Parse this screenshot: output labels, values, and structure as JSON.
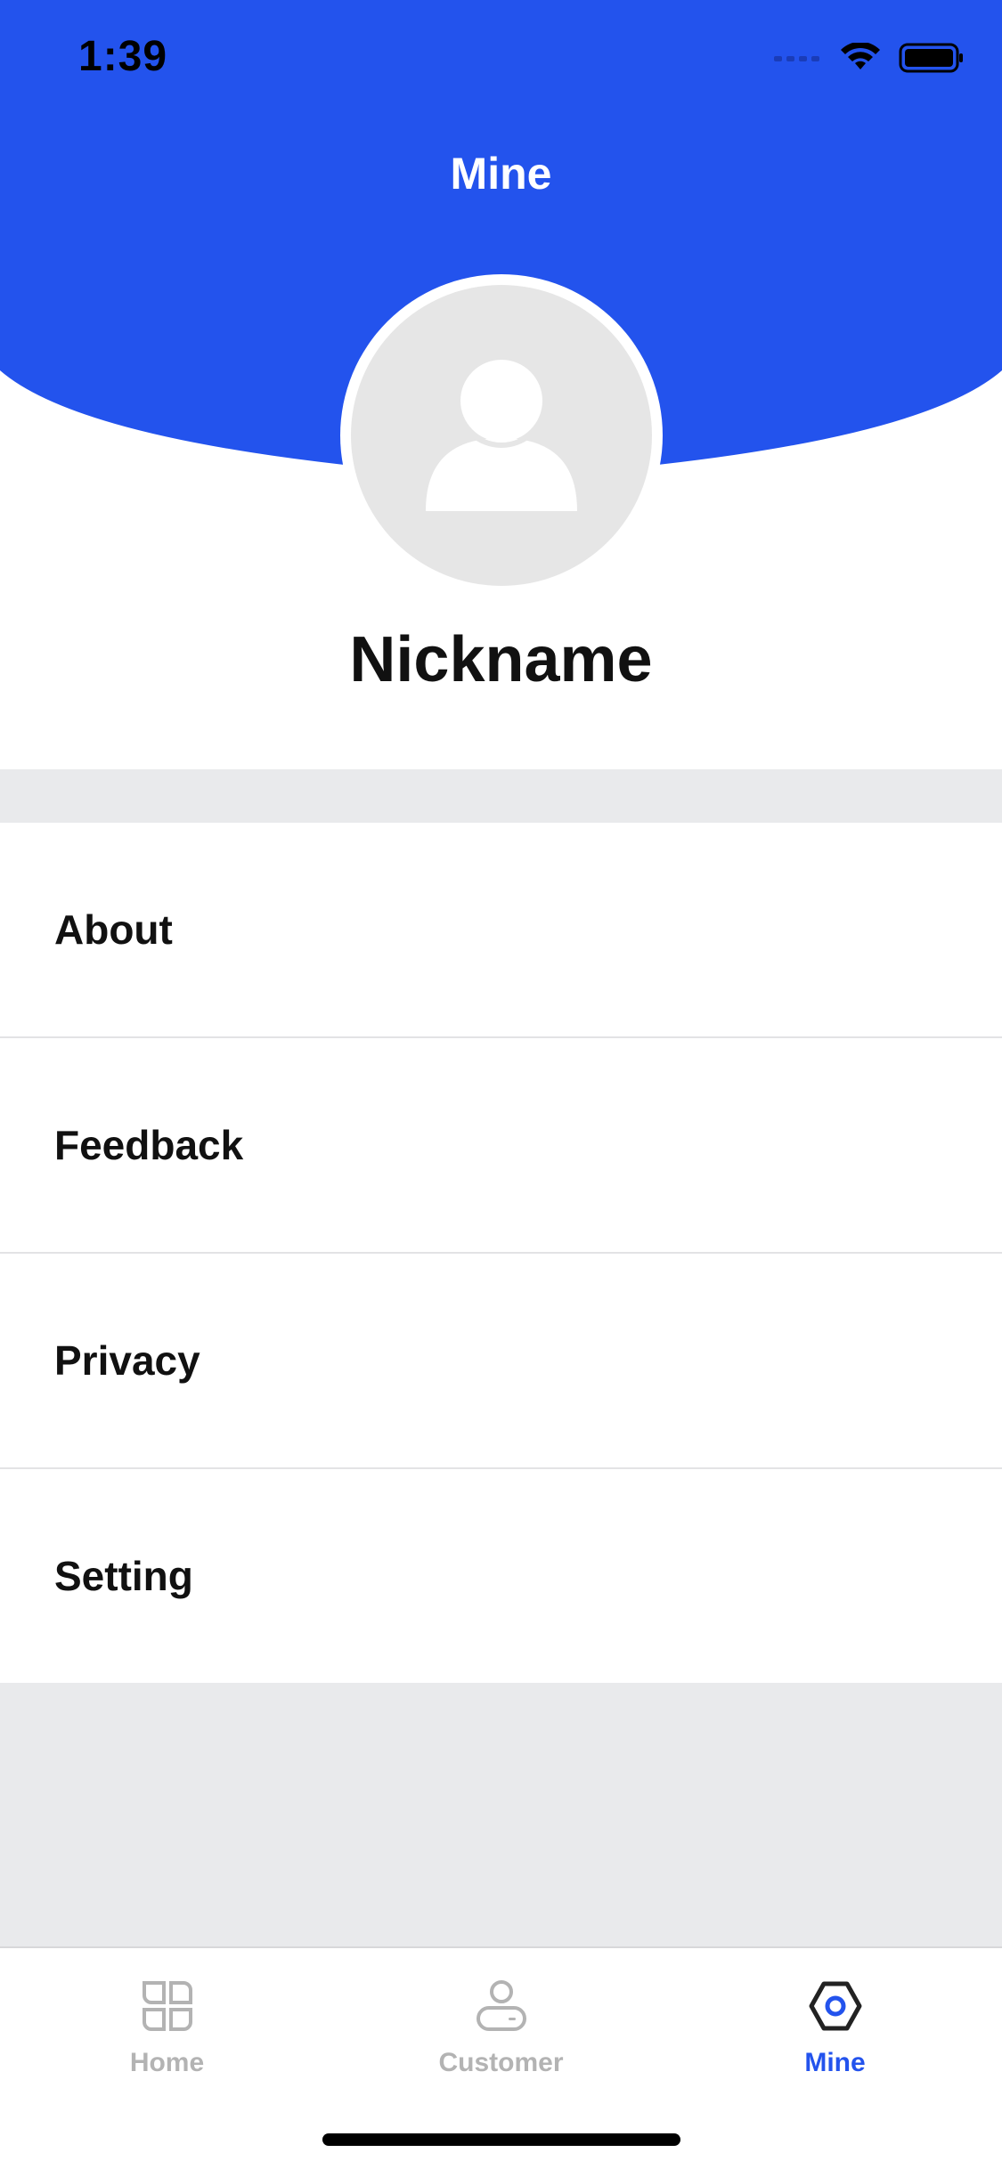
{
  "status_bar": {
    "time": "1:39"
  },
  "header": {
    "title": "Mine"
  },
  "profile": {
    "nickname": "Nickname"
  },
  "menu": {
    "items": [
      {
        "label": "About"
      },
      {
        "label": "Feedback"
      },
      {
        "label": "Privacy"
      },
      {
        "label": "Setting"
      }
    ]
  },
  "tabbar": {
    "tabs": [
      {
        "label": "Home",
        "icon": "grid-icon",
        "active": false
      },
      {
        "label": "Customer",
        "icon": "user-icon",
        "active": false
      },
      {
        "label": "Mine",
        "icon": "hexagon-icon",
        "active": true
      }
    ]
  },
  "colors": {
    "brand": "#2353ed",
    "inactive": "#b3b3b3",
    "background": "#e9eaec"
  }
}
